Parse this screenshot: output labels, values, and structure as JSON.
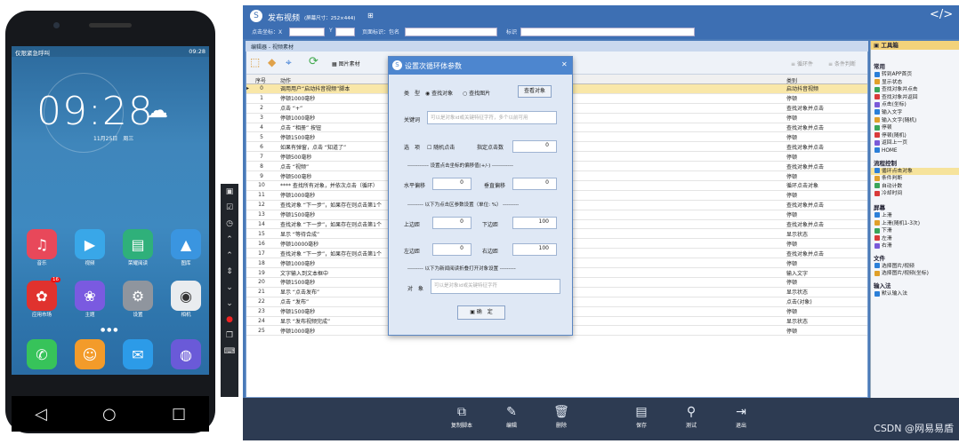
{
  "phone": {
    "status_left": "仅限紧急呼叫",
    "status_right": "09:28",
    "clock": "09:28",
    "date": "11月25日",
    "weekday": "周三",
    "row1": [
      "音乐",
      "视频",
      "荣耀阅读",
      "图库"
    ],
    "row2": [
      "应用市场",
      "主题",
      "设置",
      "相机"
    ],
    "badge": "16"
  },
  "window": {
    "title": "发布视频",
    "subtitle": "(屏幕尺寸：252×444)",
    "coord_label": "点击坐标：X",
    "y_label": "Y",
    "page_label": "页面标识：包名",
    "mark_label": "标识"
  },
  "editor": {
    "title": "编辑器 - 视频素材",
    "tool_image": "图片素材",
    "tool_loop": "循环件",
    "tool_cond": "条件判断",
    "col_no": "序号",
    "col_action": "动作",
    "col_type": "类别"
  },
  "rows": [
    {
      "n": "0",
      "a": "调用用户“启动抖音视频”脚本",
      "t": "启动抖音视频"
    },
    {
      "n": "1",
      "a": "停顿1000毫秒",
      "t": "停顿"
    },
    {
      "n": "2",
      "a": "点击 “+”",
      "t": "查找对象并点击"
    },
    {
      "n": "3",
      "a": "停顿1000毫秒",
      "t": "停顿"
    },
    {
      "n": "4",
      "a": "点击 “相册” 按钮",
      "t": "查找对象并点击"
    },
    {
      "n": "5",
      "a": "停顿1500毫秒",
      "t": "停顿"
    },
    {
      "n": "6",
      "a": "如果有弹窗，点击 “知道了”",
      "t": "查找对象并点击"
    },
    {
      "n": "7",
      "a": "停顿500毫秒",
      "t": "停顿"
    },
    {
      "n": "8",
      "a": "点击 “视频”",
      "t": "查找对象并点击"
    },
    {
      "n": "9",
      "a": "停顿500毫秒",
      "t": "停顿"
    },
    {
      "n": "10",
      "a": "**** 查找所有对象，并依次点击（循环）",
      "t": "循环点击对象"
    },
    {
      "n": "11",
      "a": "停顿1000毫秒",
      "t": "停顿"
    },
    {
      "n": "12",
      "a": "查找对象 “下一步”，如果存在则点击第1个",
      "t": "查找对象并点击"
    },
    {
      "n": "13",
      "a": "停顿1500毫秒",
      "t": "停顿"
    },
    {
      "n": "14",
      "a": "查找对象 “下一步”，如果存在则点击第1个",
      "t": "查找对象并点击"
    },
    {
      "n": "15",
      "a": "显示 “等待合成”",
      "t": "显示状态"
    },
    {
      "n": "16",
      "a": "停顿10000毫秒",
      "t": "停顿"
    },
    {
      "n": "17",
      "a": "查找对象 “下一步”，如果存在则点击第1个",
      "t": "查找对象并点击"
    },
    {
      "n": "18",
      "a": "停顿1000毫秒",
      "t": "停顿"
    },
    {
      "n": "19",
      "a": "文字输入到文本框中",
      "t": "输入文字"
    },
    {
      "n": "20",
      "a": "停顿1500毫秒",
      "t": "停顿"
    },
    {
      "n": "21",
      "a": "显示 “点击发布”",
      "t": "显示状态"
    },
    {
      "n": "22",
      "a": "点击 “发布”",
      "t": "点击(对象)"
    },
    {
      "n": "23",
      "a": "停顿1500毫秒",
      "t": "停顿"
    },
    {
      "n": "24",
      "a": "显示 “发布视频完成”",
      "t": "显示状态"
    },
    {
      "n": "25",
      "a": "停顿1000毫秒",
      "t": "停顿"
    }
  ],
  "toolbox": {
    "title": "工具箱",
    "sec_common": "常用",
    "common": [
      "转到APP首页",
      "显示状态",
      "查找对象并点击",
      "查找对象并返回",
      "点击(坐标)",
      "输入文字",
      "输入文字(随机)",
      "停顿",
      "停顿(随机)",
      "返回上一页",
      "HOME"
    ],
    "sec_flow": "流程控制",
    "flow": [
      "循环点击对象",
      "条件判断",
      "自动计数",
      "冷却时间"
    ],
    "sec_screen": "屏幕",
    "screen": [
      "上滑",
      "上滑(随机1-3次)",
      "下滑",
      "左滑",
      "右滑"
    ],
    "sec_file": "文件",
    "file": [
      "选择图片/视频",
      "选择图片/视频(坐标)"
    ],
    "sec_input": "输入法",
    "input": [
      "默认输入法"
    ]
  },
  "bottom": {
    "labels": [
      "复制脚本",
      "编辑",
      "删除",
      "保存",
      "测试",
      "退出"
    ]
  },
  "dialog": {
    "title": "设置次循环体参数",
    "type_label": "类　型",
    "opt_find": "查找对象",
    "opt_image": "查找图片",
    "view_btn": "查看对象",
    "keyword_label": "关键词",
    "keyword_ph": "可以是对象id或关键特征字符，多个以前可用",
    "options_label": "选　项",
    "random_click": "随机点击",
    "fixed_count_label": "指定点击数",
    "fixed_count": "0",
    "sep_offset": "------------ 设置点击坐标的偏移值(+/-) ------------",
    "h_label": "水平偏移",
    "h_val": "0",
    "v_label": "垂直偏移",
    "v_val": "0",
    "sep_area": "--------- 以下为点击区参数设置（单位: %） ---------",
    "top_label": "上边距",
    "top_val": "0",
    "bottom_label": "下边距",
    "bottom_val": "100",
    "left_label": "左边距",
    "left_val": "0",
    "right_label": "右边距",
    "right_val": "100",
    "sep_page": "--------- 以下为新闻阅读折叠打开对象设置 ---------",
    "obj_label": "对　象",
    "obj_ph": "可以是对象id或关键特征字符",
    "ok_btn": "确　定"
  },
  "watermark": "CSDN @网易易盾"
}
